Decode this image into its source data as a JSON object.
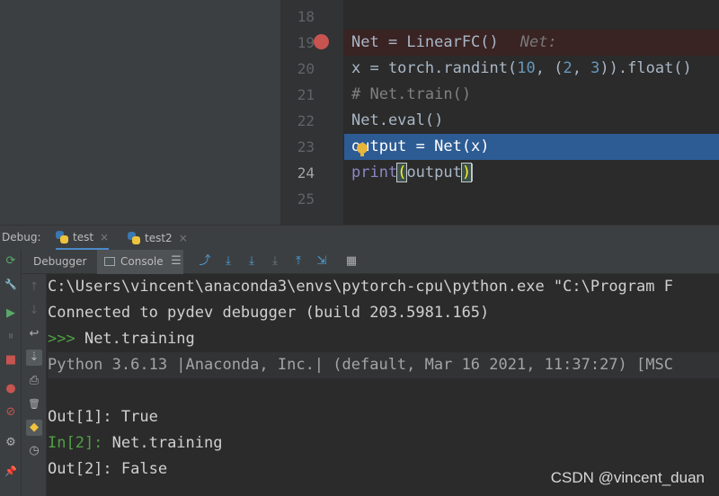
{
  "editor": {
    "lines": [
      {
        "n": "18",
        "parts": []
      },
      {
        "n": "19",
        "parts": [
          [
            "",
            "Net = LinearFC()"
          ],
          [
            "inlay",
            "Net:"
          ]
        ]
      },
      {
        "n": "20",
        "parts": [
          [
            "",
            "x = torch.randint("
          ],
          [
            "num",
            "10"
          ],
          [
            "",
            ", ("
          ],
          [
            "num",
            "2"
          ],
          [
            "",
            ", "
          ],
          [
            "num",
            "3"
          ],
          [
            "",
            ")).float()"
          ]
        ]
      },
      {
        "n": "21",
        "parts": [
          [
            "cmt",
            "# Net.train()"
          ]
        ]
      },
      {
        "n": "22",
        "parts": [
          [
            "",
            "Net.eval()"
          ]
        ]
      },
      {
        "n": "23",
        "parts": [
          [
            "",
            "output = Net(x)"
          ]
        ]
      },
      {
        "n": "24",
        "parts": [
          [
            "kw",
            "print"
          ],
          [
            "brace",
            "("
          ],
          [
            "",
            "output"
          ],
          [
            "brace",
            ")"
          ]
        ]
      },
      {
        "n": "25",
        "parts": []
      }
    ]
  },
  "debug": {
    "label": "Debug:",
    "tabs": [
      {
        "label": "test",
        "close": "×"
      },
      {
        "label": "test2",
        "close": "×"
      }
    ],
    "debugger_tab": "Debugger",
    "console_tab": "Console"
  },
  "icons": {
    "rerun": "⟳",
    "wrench": "🔧",
    "resume": "▶",
    "pause": "⏸",
    "stop": "■",
    "mute": "●",
    "skip": "⊘",
    "settings": "⚙",
    "pin": "📌",
    "menu": "☰",
    "show_exec": "⤴",
    "step_over": "⤓",
    "step_into": "⤓",
    "step_into_my": "⤓",
    "step_out": "⤒",
    "run_to_cursor": "⇲",
    "evaluate": "▦",
    "up": "↑",
    "down": "↓",
    "wrap": "↩",
    "scroll_end": "⇣",
    "print": "⎙",
    "trash": "🗑",
    "python": "◆",
    "clock": "◷"
  },
  "console": {
    "lines": [
      {
        "prompt": "",
        "text": "C:\\Users\\vincent\\anaconda3\\envs\\pytorch-cpu\\python.exe \"C:\\Program F"
      },
      {
        "prompt": "",
        "text": "Connected to pydev debugger (build 203.5981.165)"
      },
      {
        "prompt": ">>> ",
        "text": "Net.training"
      },
      {
        "prompt": "",
        "text": "Python 3.6.13 |Anaconda, Inc.| (default, Mar 16 2021, 11:37:27) [MSC"
      },
      {
        "prompt": "",
        "text": ""
      },
      {
        "prompt": "",
        "text": "Out[1]: True"
      },
      {
        "prompt": "In[2]: ",
        "text": "Net.training"
      },
      {
        "prompt": "",
        "text": "Out[2]: False"
      }
    ]
  },
  "watermark": "CSDN @vincent_duan"
}
